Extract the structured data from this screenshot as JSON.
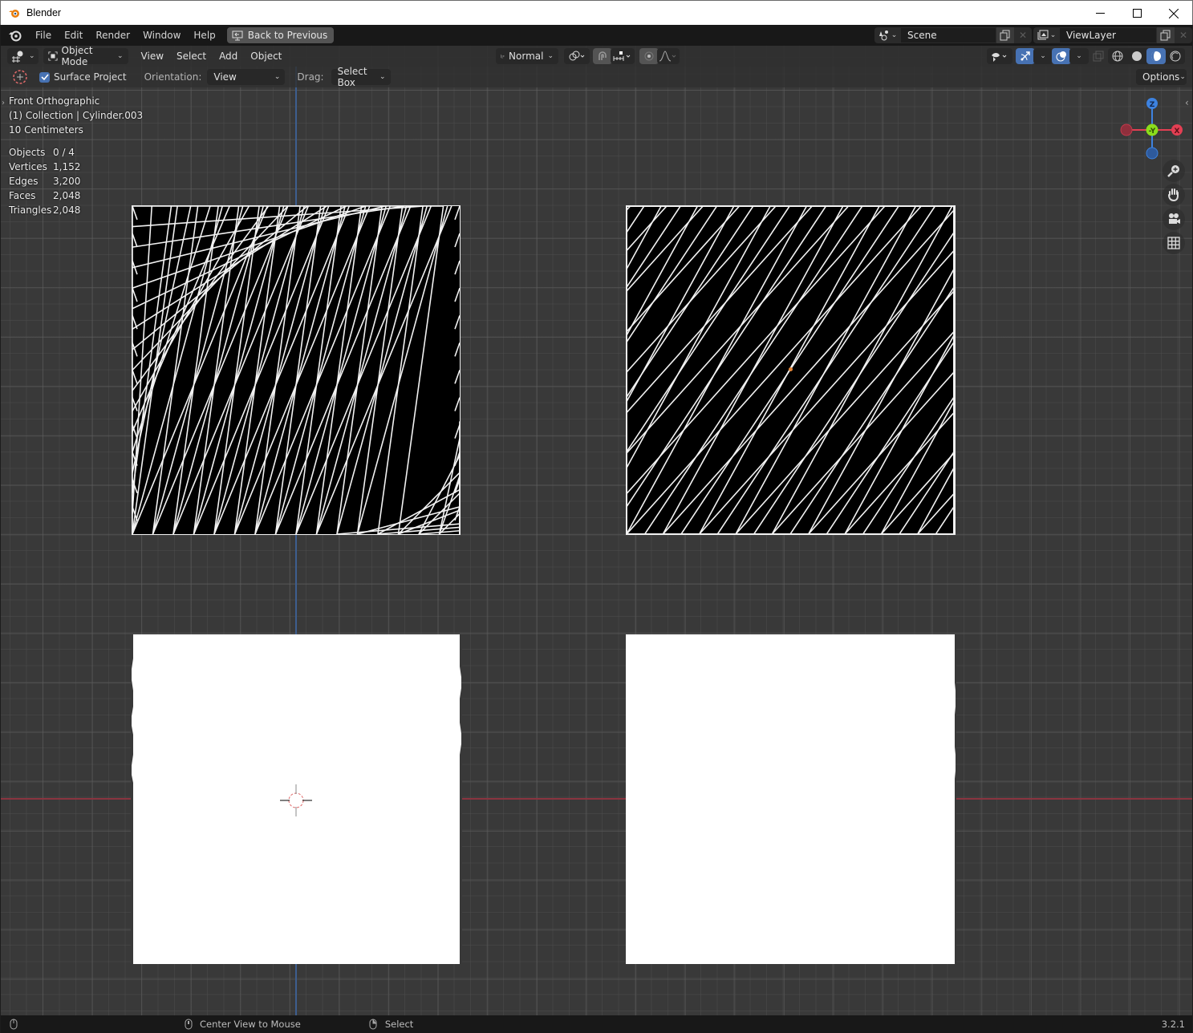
{
  "window": {
    "title": "Blender",
    "controls": [
      "minimize-icon",
      "maximize-icon",
      "close-icon"
    ]
  },
  "menubar": {
    "items": [
      "File",
      "Edit",
      "Render",
      "Window",
      "Help"
    ],
    "back_button": "Back to Previous",
    "scene": {
      "name": "Scene"
    },
    "view_layer": {
      "name": "ViewLayer"
    }
  },
  "viewport_header": {
    "mode": "Object Mode",
    "menus": [
      "View",
      "Select",
      "Add",
      "Object"
    ],
    "transform_orientation": "Normal",
    "options_label": "Options"
  },
  "tool_header": {
    "surface_project_label": "Surface Project",
    "surface_project_checked": true,
    "orientation_label": "Orientation:",
    "orientation_value": "View",
    "drag_label": "Drag:",
    "drag_value": "Select Box"
  },
  "overlay": {
    "view_name": "Front Orthographic",
    "collection": "(1) Collection | Cylinder.003",
    "scale": "10 Centimeters"
  },
  "stats": [
    {
      "label": "Objects",
      "value": "0 / 4"
    },
    {
      "label": "Vertices",
      "value": "1,152"
    },
    {
      "label": "Edges",
      "value": "3,200"
    },
    {
      "label": "Faces",
      "value": "2,048"
    },
    {
      "label": "Triangles",
      "value": "2,048"
    }
  ],
  "gizmo": {
    "z": "Z",
    "y": "-Y",
    "x": "X",
    "colors": {
      "x": "#e33f53",
      "y": "#8bdc1b",
      "z": "#3d82e0"
    }
  },
  "statusbar": {
    "middle_mouse": "Center View to Mouse",
    "right_mouse": "Select",
    "version": "3.2.1"
  },
  "colors": {
    "accent": "#4772b3",
    "viewport_bg": "#393939",
    "header_bg": "#303030"
  }
}
